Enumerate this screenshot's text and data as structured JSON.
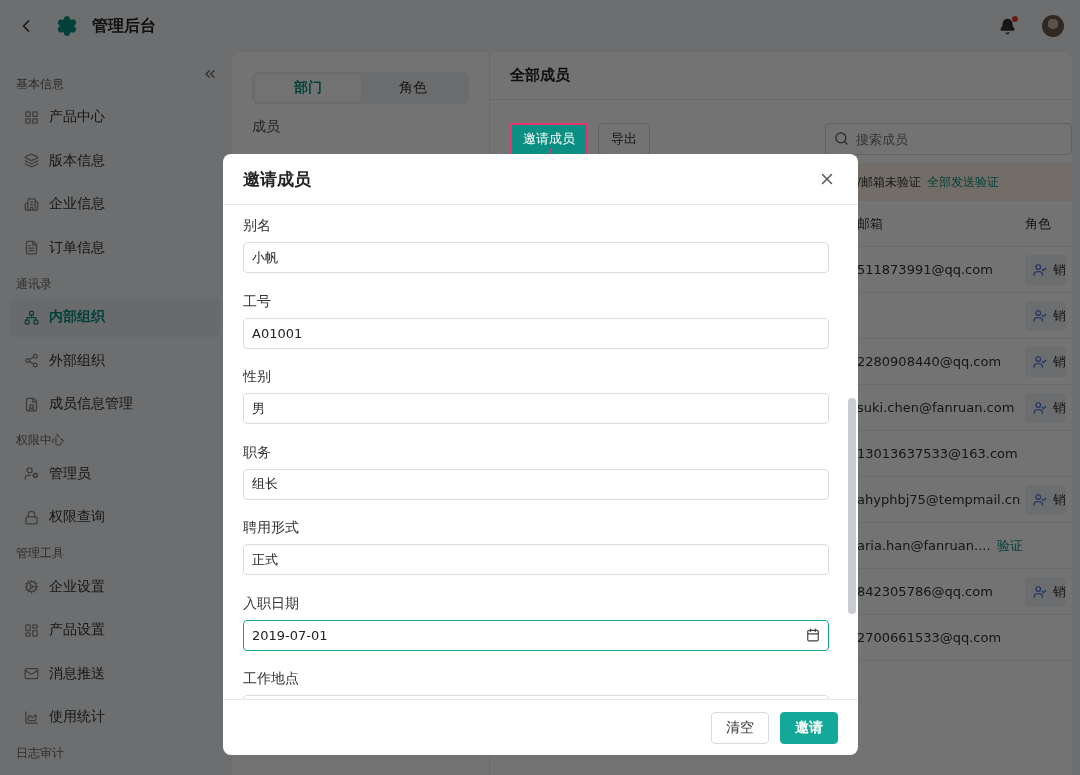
{
  "header": {
    "title": "管理后台",
    "has_unread": true
  },
  "sidebar": {
    "sections": [
      {
        "title": "基本信息",
        "items": [
          {
            "label": "产品中心",
            "selected": false
          },
          {
            "label": "版本信息",
            "selected": false
          },
          {
            "label": "企业信息",
            "selected": false
          },
          {
            "label": "订单信息",
            "selected": false
          }
        ]
      },
      {
        "title": "通讯录",
        "items": [
          {
            "label": "内部组织",
            "selected": true
          },
          {
            "label": "外部组织",
            "selected": false
          },
          {
            "label": "成员信息管理",
            "selected": false
          }
        ]
      },
      {
        "title": "权限中心",
        "items": [
          {
            "label": "管理员",
            "selected": false
          },
          {
            "label": "权限查询",
            "selected": false
          }
        ]
      },
      {
        "title": "管理工具",
        "items": [
          {
            "label": "企业设置",
            "selected": false
          },
          {
            "label": "产品设置",
            "selected": false
          },
          {
            "label": "消息推送",
            "selected": false
          },
          {
            "label": "使用统计",
            "selected": false
          }
        ]
      },
      {
        "title": "日志审计"
      }
    ]
  },
  "org_panel": {
    "tabs": [
      {
        "label": "部门",
        "selected": true
      },
      {
        "label": "角色",
        "selected": false
      }
    ],
    "section_label": "成员"
  },
  "members_panel": {
    "title": "全部成员",
    "invite_button": {
      "label": "邀请成员",
      "highlighted": true
    },
    "export_button": "导出",
    "search": {
      "placeholder": "搜索成员"
    },
    "notice": {
      "text": "/邮箱未验证",
      "action": "全部发送验证"
    },
    "columns": [
      "邮箱",
      "角色"
    ],
    "rows": [
      {
        "email": "511873991@qq.com",
        "role": "销"
      },
      {
        "role": "销"
      },
      {
        "email": "2280908440@qq.com",
        "role": "销"
      },
      {
        "email": "suki.chen@fanruan.com",
        "role": "销"
      },
      {
        "email": "13013637533@163.com"
      },
      {
        "email": "ahyphbj75@tempmail.cn",
        "role": "销"
      },
      {
        "email": "aria.han@fanruan....",
        "verify": "验证"
      },
      {
        "email": "842305786@qq.com",
        "role": "销"
      },
      {
        "email": "2700661533@qq.com"
      }
    ]
  },
  "dialog": {
    "title": "邀请成员",
    "fields": [
      {
        "label": "别名",
        "value": "小帆",
        "kind": "text",
        "focused": false
      },
      {
        "label": "工号",
        "value": "A01001",
        "kind": "text",
        "focused": false
      },
      {
        "label": "性别",
        "value": "男",
        "kind": "text",
        "focused": false
      },
      {
        "label": "职务",
        "value": "组长",
        "kind": "text",
        "focused": false
      },
      {
        "label": "聘用形式",
        "value": "正式",
        "kind": "text",
        "focused": false
      },
      {
        "label": "入职日期",
        "value": "2019-07-01",
        "kind": "date",
        "focused": true
      },
      {
        "label": "工作地点",
        "kind": "text",
        "focused": false
      }
    ],
    "buttons": [
      {
        "label": "清空",
        "primary": false
      },
      {
        "label": "邀请",
        "primary": true
      }
    ]
  }
}
